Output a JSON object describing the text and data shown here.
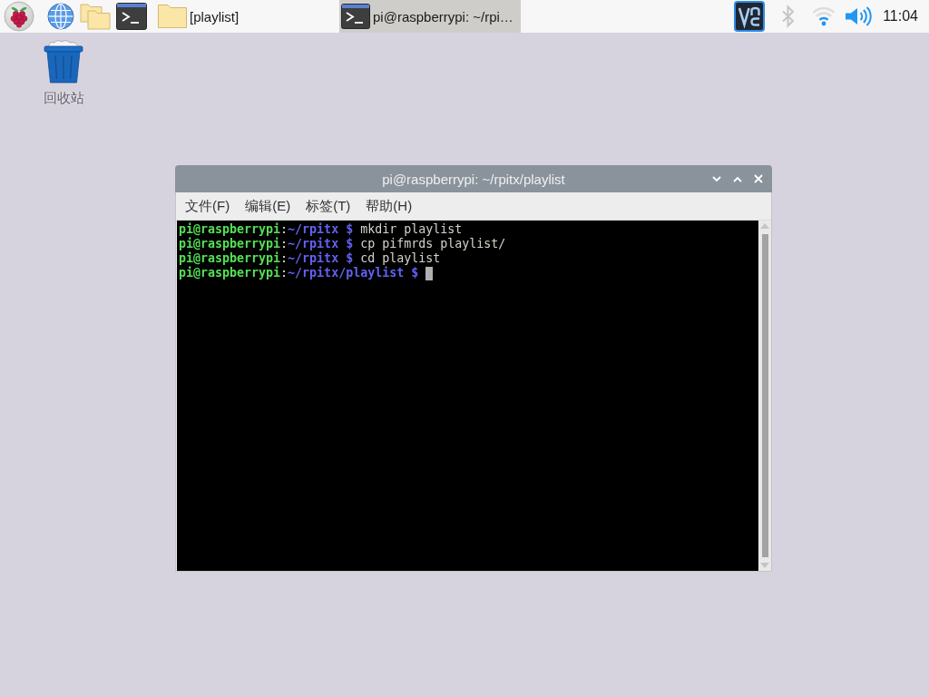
{
  "taskbar": {
    "tasks": [
      {
        "kind": "folder",
        "label": "[playlist]",
        "selected": false
      },
      {
        "kind": "terminal",
        "label": "pi@raspberrypi: ~/rpi…",
        "selected": true
      }
    ],
    "tray": {
      "bluetooth": {
        "on": false
      },
      "clock": "11:04"
    }
  },
  "desktop_icons": [
    {
      "kind": "trash",
      "label": "回收站"
    }
  ],
  "terminal_window": {
    "title": "pi@raspberrypi: ~/rpitx/playlist",
    "menu": [
      "文件(F)",
      "编辑(E)",
      "标签(T)",
      "帮助(H)"
    ],
    "lines": [
      {
        "segments": [
          {
            "kind": "user",
            "text": "pi@raspberrypi"
          },
          {
            "kind": "colon",
            "text": ":"
          },
          {
            "kind": "path",
            "text": "~/rpitx $ "
          },
          {
            "kind": "command",
            "text": "mkdir playlist"
          }
        ],
        "cursor": false
      },
      {
        "segments": [
          {
            "kind": "user",
            "text": "pi@raspberrypi"
          },
          {
            "kind": "colon",
            "text": ":"
          },
          {
            "kind": "path",
            "text": "~/rpitx $ "
          },
          {
            "kind": "command",
            "text": "cp pifmrds playlist/"
          }
        ],
        "cursor": false
      },
      {
        "segments": [
          {
            "kind": "user",
            "text": "pi@raspberrypi"
          },
          {
            "kind": "colon",
            "text": ":"
          },
          {
            "kind": "path",
            "text": "~/rpitx $ "
          },
          {
            "kind": "command",
            "text": "cd playlist"
          }
        ],
        "cursor": false
      },
      {
        "segments": [
          {
            "kind": "user",
            "text": "pi@raspberrypi"
          },
          {
            "kind": "colon",
            "text": ":"
          },
          {
            "kind": "path",
            "text": "~/rpitx/playlist $ "
          }
        ],
        "cursor": true
      }
    ]
  }
}
